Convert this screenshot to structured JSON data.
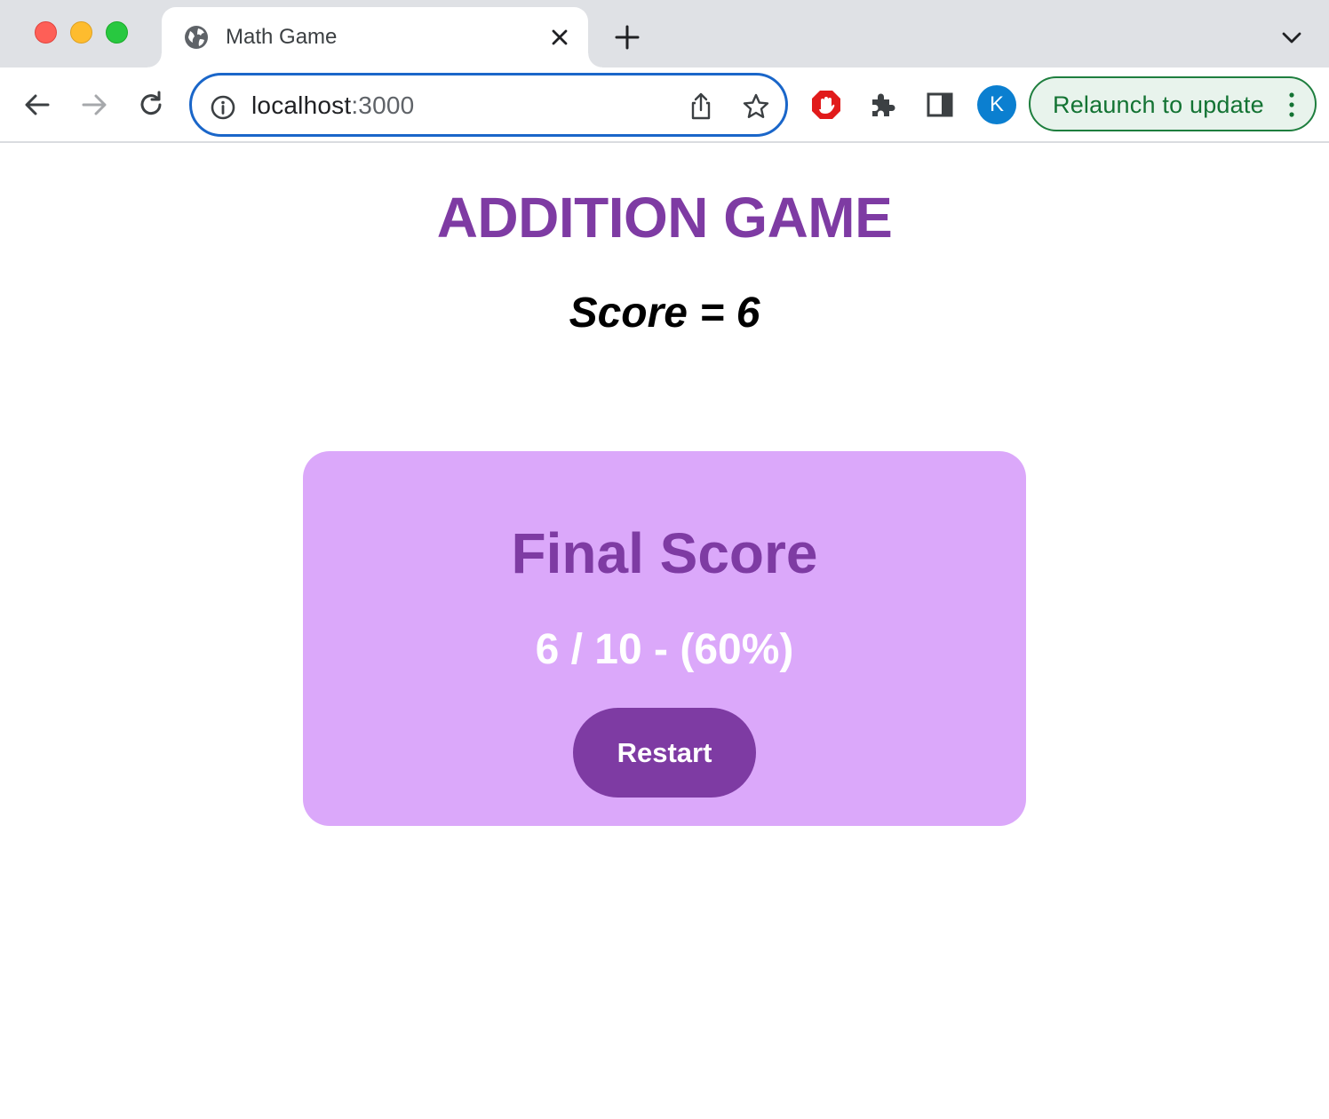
{
  "browser": {
    "tab": {
      "title": "Math Game",
      "favicon": "globe-icon"
    },
    "omnibox": {
      "host": "localhost",
      "port": ":3000"
    },
    "profile_initial": "K",
    "relaunch_label": "Relaunch to update",
    "colors": {
      "omnibox_focus": "#1a66c9",
      "relaunch_text": "#137333",
      "avatar": "#0b7fd0"
    }
  },
  "page": {
    "title": "ADDITION GAME",
    "score_text": "Score = 6",
    "final_card": {
      "heading": "Final Score",
      "result": "6 / 10 - (60%)",
      "restart_label": "Restart"
    },
    "colors": {
      "primary": "#7e3ba3",
      "card_background": "#dba8fa",
      "result_text": "#ffffff"
    }
  }
}
